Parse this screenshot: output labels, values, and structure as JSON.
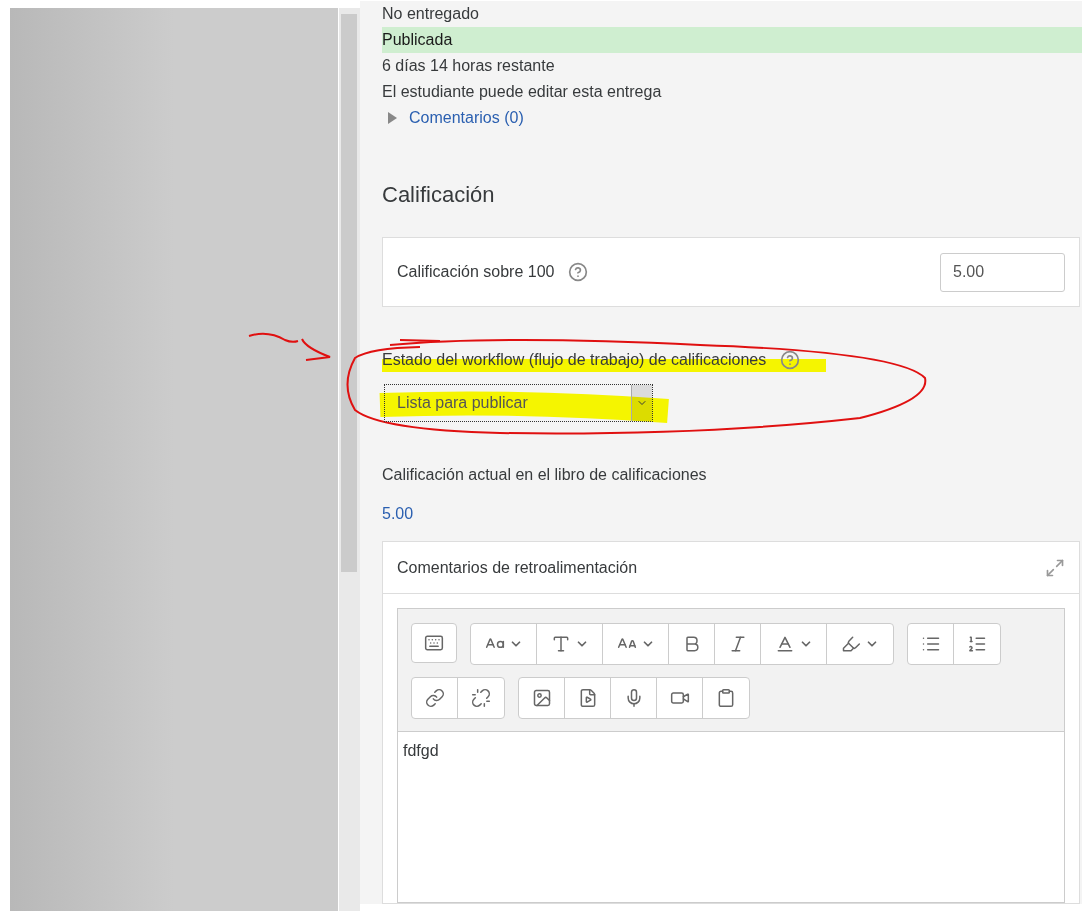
{
  "status_lines": [
    {
      "text": "No entregado",
      "highlighted": false
    },
    {
      "text": "Publicada",
      "highlighted": true
    },
    {
      "text": "6 días 14 horas restante",
      "highlighted": false
    },
    {
      "text": "El estudiante puede editar esta entrega",
      "highlighted": false
    }
  ],
  "comments_link": {
    "text": "Comentarios (0)",
    "expanded": false
  },
  "grading": {
    "title": "Calificación",
    "grade_label": "Calificación sobre 100",
    "grade_value": "5.00"
  },
  "workflow": {
    "label": "Estado del workflow (flujo de trabajo) de calificaciones",
    "value": "Lista para publicar"
  },
  "current_grade": {
    "label": "Calificación actual en el libro de calificaciones",
    "value": "5.00"
  },
  "feedback": {
    "title": "Comentarios de retroalimentación",
    "text": "fdfgd",
    "toolbar_rows": [
      [
        [
          {
            "kind": "collapse"
          }
        ],
        [
          {
            "kind": "font-family"
          },
          {
            "kind": "font-size"
          },
          {
            "kind": "style"
          },
          {
            "kind": "bold"
          },
          {
            "kind": "italic"
          },
          {
            "kind": "color"
          },
          {
            "kind": "highlight"
          }
        ],
        [
          {
            "kind": "bullet-list"
          },
          {
            "kind": "numbered-list"
          }
        ]
      ],
      [
        [
          {
            "kind": "link"
          },
          {
            "kind": "unlink"
          }
        ],
        [
          {
            "kind": "image"
          },
          {
            "kind": "media"
          },
          {
            "kind": "record-audio"
          },
          {
            "kind": "record-video"
          },
          {
            "kind": "files"
          }
        ]
      ]
    ]
  }
}
